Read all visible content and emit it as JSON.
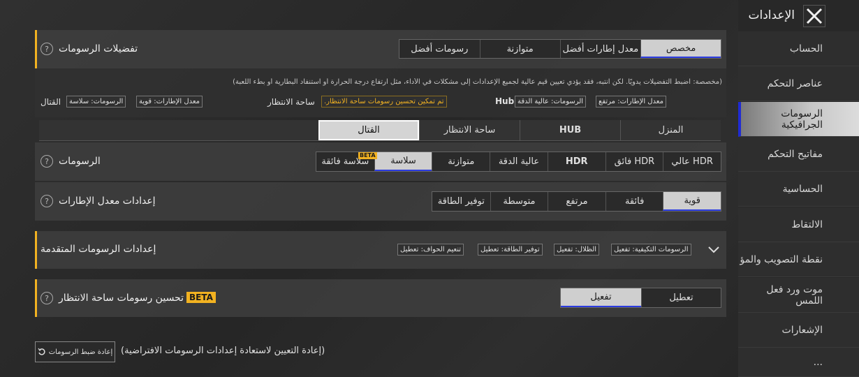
{
  "header": {
    "title": "الإعدادات"
  },
  "sidebar": {
    "items": [
      {
        "label": "الحساب",
        "active": false
      },
      {
        "label": "عناصر التحكم",
        "active": false
      },
      {
        "label": "الرسومات الجرافيكية",
        "active": true
      },
      {
        "label": "مفاتيح التحكم",
        "active": false
      },
      {
        "label": "الحساسية",
        "active": false
      },
      {
        "label": "الالتقاط",
        "active": false
      },
      {
        "label": "نقطة التصويب والمؤ",
        "active": false
      },
      {
        "label": "موت ورد فعل اللمس",
        "active": false
      },
      {
        "label": "الإشعارات",
        "active": false
      },
      {
        "label": "...",
        "active": false
      }
    ]
  },
  "prefs": {
    "title": "تفضيلات الرسومات",
    "options": [
      "مخصص",
      "معدل إطارات أفضل",
      "متوازنة",
      "رسومات أفضل"
    ],
    "selected": 0,
    "description": "(مخصصة: اضبط التفضيلات يدويًا. لكن انتبه، فقد يؤدي تعيين قيم عالية لجميع الإعدادات إلى مشكلات في الأداء، مثل ارتفاع درجة الحرارة أو استنفاد البطارية أو بطء اللعبة)",
    "summary": {
      "hub_label": "Hub",
      "hub_fps": "معدل الإطارات: مرتفع",
      "hub_gfx": "الرسومات: عالية الدقة",
      "lobby_label": "ساحة الانتظار",
      "lobby_note": "تم تمكين تحسين رسومات ساحة الانتظار.",
      "combat_label": "القتال",
      "combat_fps": "معدل الإطارات: قوية",
      "combat_gfx": "الرسومات: سلاسة"
    }
  },
  "mode_tabs": [
    "المنزل",
    "HUB",
    "ساحة الانتظار",
    "القتال"
  ],
  "mode_selected": 3,
  "graphics": {
    "title": "الرسومات",
    "options": [
      "عالي HDR",
      "فائق HDR",
      "HDR",
      "عالية الدقة",
      "متوازنة",
      "سلاسة",
      "سلاسة فائقة"
    ],
    "selected": 5,
    "beta_label": "BETA"
  },
  "fps": {
    "title": "إعدادات معدل الإطارات",
    "options": [
      "قوية",
      "فائقة",
      "مرتفع",
      "متوسطة",
      "توفير الطاقة"
    ],
    "selected": 0
  },
  "advanced": {
    "title": "إعدادات الرسومات المتقدمة",
    "chips": [
      "الرسومات التكيفية: تفعيل",
      "الظلال: تفعيل",
      "توفير الطاقة: تعطيل",
      "تنعيم الحواف: تعطيل"
    ]
  },
  "lobby_enh": {
    "title": "تحسين رسومات ساحة الانتظار",
    "beta": "BETA",
    "options": [
      "تعطيل",
      "تفعيل"
    ],
    "selected": 1
  },
  "reset": {
    "button": "إعادة ضبط الرسومات",
    "note": "(إعادة التعيين لاستعادة إعدادات الرسومات الافتراضية)"
  }
}
